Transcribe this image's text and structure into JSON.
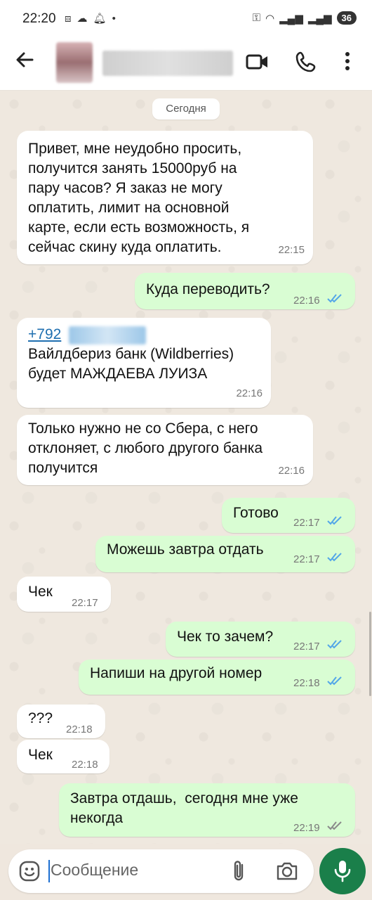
{
  "status": {
    "time": "22:20",
    "battery": "36"
  },
  "header": {
    "contact_name": "",
    "icons": [
      "back-arrow-icon",
      "video-call-icon",
      "phone-call-icon",
      "more-vert-icon"
    ]
  },
  "day_label": "Сегодня",
  "messages": [
    {
      "dir": "in",
      "text": "Привет, мне неудобно просить,\nполучится занять 15000руб на\nпару часов? Я заказ не могу\nоплатить, лимит на основной\nкарте, если есть возможность, я\nсейчас скину куда оплатить.",
      "time": "22:15"
    },
    {
      "dir": "out",
      "text": "Куда переводить?",
      "time": "22:16",
      "status": "read"
    },
    {
      "dir": "in",
      "link": "+792",
      "text": "Вайлдбериз банк (Wildberries)\nбудет МАЖДАЕВА ЛУИЗА",
      "time": "22:16"
    },
    {
      "dir": "in",
      "text": "Только нужно не со Сбера, с него\nотклоняет, с любого другого банка\nполучится",
      "time": "22:16"
    },
    {
      "dir": "out",
      "text": "Готово",
      "time": "22:17",
      "status": "read"
    },
    {
      "dir": "out",
      "text": "Можешь завтра отдать",
      "time": "22:17",
      "status": "read"
    },
    {
      "dir": "in",
      "text": "Чек",
      "time": "22:17"
    },
    {
      "dir": "out",
      "text": "Чек то зачем?",
      "time": "22:17",
      "status": "read"
    },
    {
      "dir": "out",
      "text": "Напиши на другой номер",
      "time": "22:18",
      "status": "read"
    },
    {
      "dir": "in",
      "text": "???",
      "time": "22:18"
    },
    {
      "dir": "in",
      "text": "Чек",
      "time": "22:18"
    },
    {
      "dir": "out",
      "text": "Завтра отдашь,  сегодня мне уже\nнекогда",
      "time": "22:19",
      "status": "delivered"
    }
  ],
  "composer": {
    "placeholder": "Сообщение"
  },
  "colors": {
    "incoming_bubble": "#ffffff",
    "outgoing_bubble": "#d9fdd3",
    "read_ticks": "#53a6e8",
    "mic_button": "#1a7f4a"
  }
}
